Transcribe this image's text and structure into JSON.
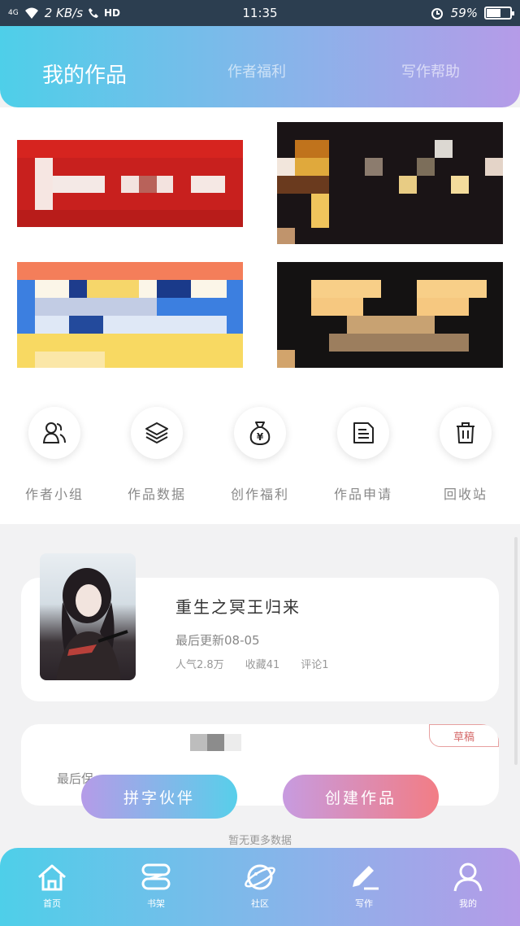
{
  "status_bar": {
    "network": "4G",
    "speed": "2 KB/s",
    "hd": "HD",
    "time": "11:35",
    "battery": "59%",
    "battery_level": 0.59
  },
  "header": {
    "tabs": [
      {
        "label": "我的作品",
        "active": true
      },
      {
        "label": "作者福利",
        "active": false
      },
      {
        "label": "写作帮助",
        "active": false
      }
    ]
  },
  "quick_actions": [
    {
      "label": "作者小组",
      "icon": "author-group-icon"
    },
    {
      "label": "作品数据",
      "icon": "layers-icon"
    },
    {
      "label": "创作福利",
      "icon": "money-bag-icon"
    },
    {
      "label": "作品申请",
      "icon": "document-icon"
    },
    {
      "label": "回收站",
      "icon": "trash-icon"
    }
  ],
  "works": [
    {
      "title": "重生之冥王归来",
      "update": "最后更新08-05",
      "stats": [
        "人气2.8万",
        "收藏41",
        "评论1"
      ]
    },
    {
      "draft_badge": "草稿",
      "update": "最后保..."
    }
  ],
  "buttons": {
    "partner": "拼字伙伴",
    "create": "创建作品"
  },
  "no_more_data": "暂无更多数据",
  "bottom_nav": [
    {
      "label": "首页",
      "icon": "home-icon"
    },
    {
      "label": "书架",
      "icon": "bookshelf-icon"
    },
    {
      "label": "社区",
      "icon": "planet-icon"
    },
    {
      "label": "写作",
      "icon": "pen-icon"
    },
    {
      "label": "我的",
      "icon": "user-icon"
    }
  ],
  "colors": {
    "gradient_start": "#4ecfe9",
    "gradient_end": "#b59be8",
    "create_button_end": "#f27d85"
  }
}
